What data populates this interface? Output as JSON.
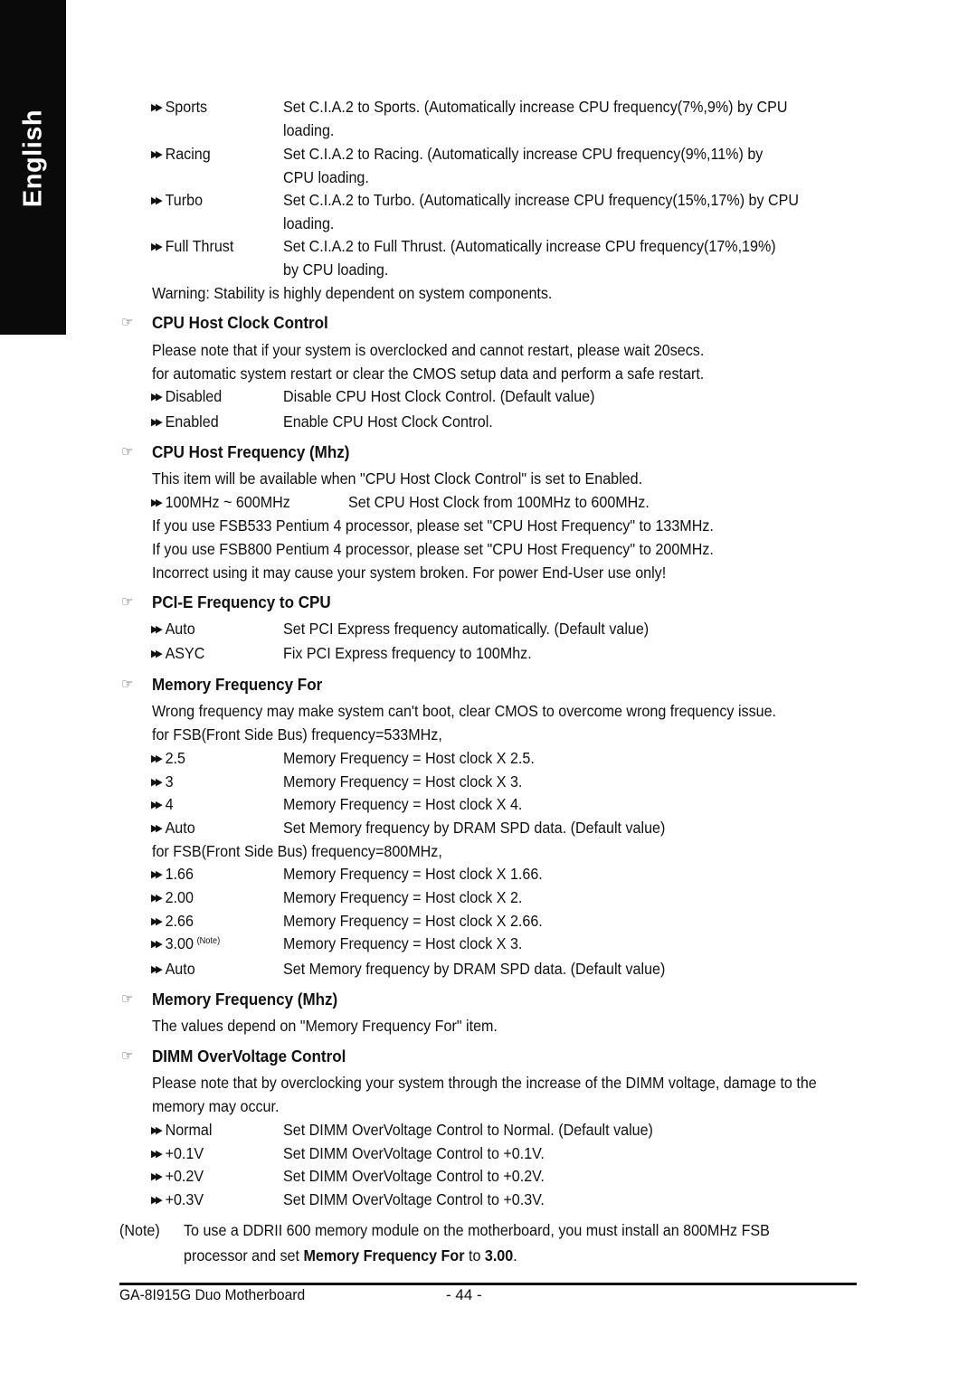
{
  "side_tab": {
    "label": "English"
  },
  "cia2_options": [
    {
      "option": "Sports",
      "desc1": "Set C.I.A.2 to Sports. (Automatically increase CPU frequency(7%,9%) by CPU",
      "desc2": "loading."
    },
    {
      "option": "Racing",
      "desc1": "Set C.I.A.2 to Racing. (Automatically increase CPU frequency(9%,11%) by",
      "desc2": "CPU loading."
    },
    {
      "option": "Turbo",
      "desc1": "Set C.I.A.2 to Turbo. (Automatically increase CPU frequency(15%,17%) by CPU",
      "desc2": "loading."
    },
    {
      "option": "Full Thrust",
      "desc1": "Set C.I.A.2 to Full Thrust. (Automatically increase CPU frequency(17%,19%)",
      "desc2": "by CPU loading."
    }
  ],
  "cia2_warning": "Warning: Stability is highly dependent on system components.",
  "cpu_host_clock": {
    "title": "CPU Host Clock Control",
    "para": [
      "Please note that if your system is overclocked and cannot restart, please wait 20secs.",
      "for automatic system restart or clear the CMOS setup data and perform a safe restart."
    ],
    "options": [
      {
        "option": "Disabled",
        "desc": "Disable CPU Host Clock Control. (Default value)"
      },
      {
        "option": "Enabled",
        "desc": "Enable CPU Host Clock Control."
      }
    ]
  },
  "cpu_host_freq": {
    "title": "CPU Host Frequency (Mhz)",
    "para": "This item will be available when \"CPU Host Clock Control\" is set to Enabled.",
    "options": [
      {
        "option": "100MHz ~ 600MHz",
        "desc": "Set CPU Host Clock from 100MHz to 600MHz."
      }
    ],
    "notes": [
      "If you use FSB533 Pentium 4 processor, please set \"CPU Host Frequency\" to 133MHz.",
      "If you use FSB800 Pentium 4 processor, please set \"CPU Host Frequency\" to 200MHz.",
      "Incorrect using it may cause your system broken. For power End-User use only!"
    ]
  },
  "pcie_freq": {
    "title": "PCI-E Frequency to CPU",
    "options": [
      {
        "option": "Auto",
        "desc": "Set PCI Express frequency automatically. (Default value)"
      },
      {
        "option": "ASYC",
        "desc": "Fix PCI Express frequency to 100Mhz."
      }
    ]
  },
  "mem_freq_for": {
    "title": "Memory Frequency For",
    "para": "Wrong frequency may make system can't boot, clear CMOS to overcome wrong frequency issue.",
    "fsb533_label": "for FSB(Front Side Bus) frequency=533MHz,",
    "fsb533_options": [
      {
        "option": "2.5",
        "desc": "Memory Frequency = Host clock X 2.5."
      },
      {
        "option": "3",
        "desc": "Memory Frequency = Host clock X 3."
      },
      {
        "option": "4",
        "desc": "Memory Frequency = Host clock X 4."
      },
      {
        "option": "Auto",
        "desc": "Set Memory frequency by DRAM SPD data. (Default value)"
      }
    ],
    "fsb800_label": "for FSB(Front Side Bus) frequency=800MHz,",
    "fsb800_options": [
      {
        "option": "1.66",
        "desc": "Memory Frequency = Host clock X 1.66."
      },
      {
        "option": "2.00",
        "desc": "Memory Frequency = Host clock X 2."
      },
      {
        "option": "2.66",
        "desc": "Memory Frequency = Host clock X 2.66."
      },
      {
        "option": "3.00",
        "sup": "(Note)",
        "desc": "Memory Frequency = Host clock X 3."
      },
      {
        "option": "Auto",
        "desc": "Set Memory frequency by DRAM SPD data. (Default value)"
      }
    ]
  },
  "mem_freq_mhz": {
    "title": "Memory Frequency (Mhz)",
    "para": "The values depend on \"Memory Frequency For\" item."
  },
  "dimm_ov": {
    "title": "DIMM OverVoltage Control",
    "para": [
      "Please note that by overclocking your system through the increase of the DIMM voltage, damage to the",
      "memory may occur."
    ],
    "options": [
      {
        "option": "Normal",
        "desc": "Set DIMM OverVoltage Control to Normal. (Default value)"
      },
      {
        "option": "+0.1V",
        "desc": "Set DIMM OverVoltage Control to +0.1V."
      },
      {
        "option": "+0.2V",
        "desc": "Set DIMM OverVoltage Control to +0.2V."
      },
      {
        "option": "+0.3V",
        "desc": "Set DIMM OverVoltage Control to +0.3V."
      }
    ]
  },
  "note": {
    "label": "(Note)",
    "line1": "To use a DDRII 600 memory module on the motherboard, you must install an 800MHz FSB",
    "line2_pre": "processor and set ",
    "line2_bold1": "Memory Frequency For",
    "line2_mid": " to ",
    "line2_bold2": "3.00",
    "line2_post": "."
  },
  "footer": {
    "product": "GA-8I915G Duo Motherboard",
    "page": "- 44 -"
  },
  "icons": {
    "bullet": "double-arrow-icon",
    "heading": "pointing-hand-icon"
  }
}
